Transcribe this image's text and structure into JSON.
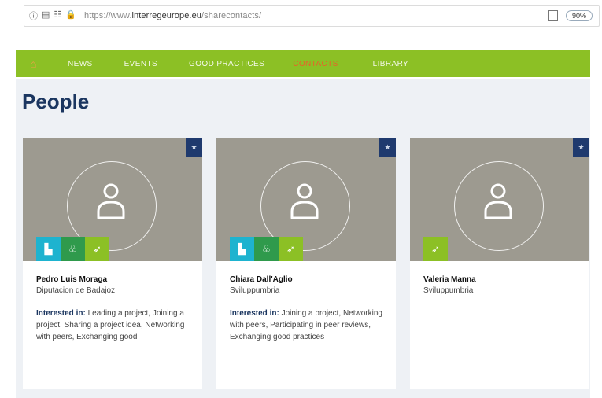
{
  "browser": {
    "url_prefix": "https://www.",
    "url_domain": "interregeurope.eu",
    "url_path": "/sharecontacts/",
    "zoom": "90%"
  },
  "nav": {
    "items": [
      {
        "label": "NEWS",
        "active": false
      },
      {
        "label": "EVENTS",
        "active": false
      },
      {
        "label": "GOOD PRACTICES",
        "active": false
      },
      {
        "label": "CONTACTS",
        "active": true
      },
      {
        "label": "LIBRARY",
        "active": false
      }
    ]
  },
  "page": {
    "title": "People"
  },
  "people": [
    {
      "name": "Pedro Luis Moraga",
      "organization": "Diputacion de Badajoz",
      "interested_label": "Interested in:",
      "interests": "Leading a project, Joining a project, Sharing a project idea, Networking with peers, Exchanging good",
      "badges": [
        "building-icon",
        "tree-icon",
        "leaf-icon"
      ]
    },
    {
      "name": "Chiara Dall'Aglio",
      "organization": "Sviluppumbria",
      "interested_label": "Interested in:",
      "interests": "Joining a project, Networking with peers, Participating in peer reviews, Exchanging good practices",
      "badges": [
        "building-icon",
        "tree-icon",
        "leaf-icon"
      ]
    },
    {
      "name": "Valeria Manna",
      "organization": "Sviluppumbria",
      "interested_label": "",
      "interests": "",
      "badges": [
        "leaf-icon"
      ]
    }
  ],
  "colors": {
    "nav_bg": "#8cc025",
    "title": "#1b3660",
    "card_image": "#9d9a90",
    "star_bg": "#1f3a6e",
    "badge_teal": "#1eb3cf",
    "badge_green": "#2f9a4c",
    "badge_lime": "#8cc025",
    "active_nav": "#e8602a"
  }
}
